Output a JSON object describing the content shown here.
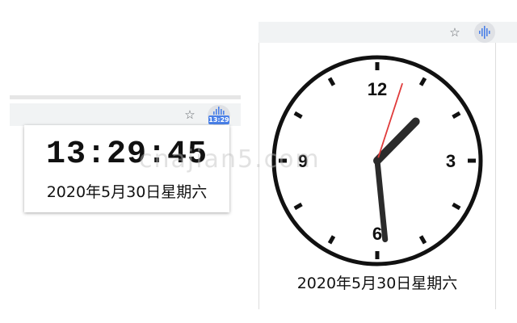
{
  "left_popup": {
    "time": "13:29:45",
    "date": "2020年5月30日星期六"
  },
  "left_toolbar": {
    "bookmark_icon": "star-outline-icon",
    "extension_icon": "audio-bars-icon",
    "badge_text": "13:29"
  },
  "right_toolbar": {
    "bookmark_icon": "star-outline-icon",
    "extension_icon": "audio-bars-icon"
  },
  "analog_clock": {
    "numerals": {
      "n12": "12",
      "n3": "3",
      "n6": "6",
      "n9": "9"
    },
    "hours": 13,
    "minutes": 29,
    "seconds": 3,
    "date": "2020年5月30日星期六",
    "second_hand_color": "#e03b3b",
    "hand_color": "#2b2b2b"
  },
  "watermark": "cnajian5.com",
  "colors": {
    "toolbar_bg": "#f1f3f4",
    "badge_bg": "#4a80e8",
    "icon_blue": "#4a80e8"
  }
}
